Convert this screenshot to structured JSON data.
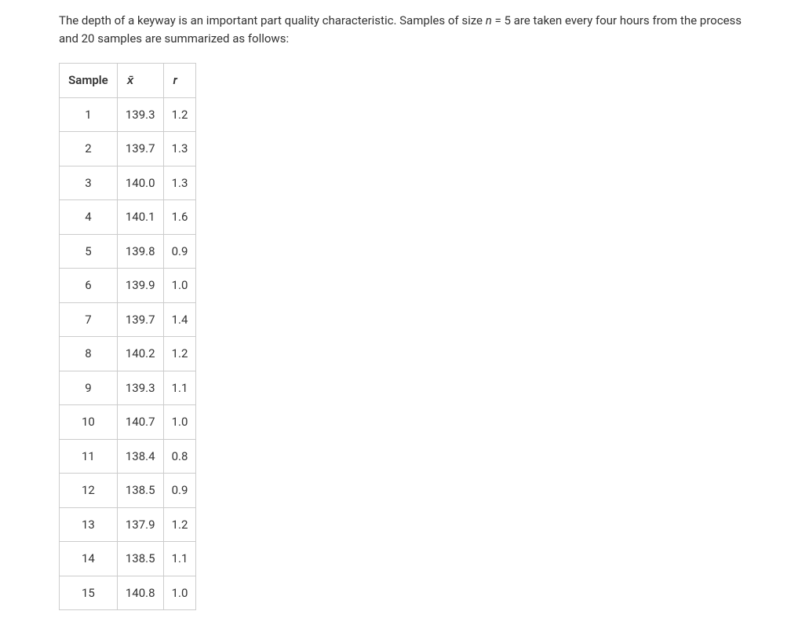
{
  "problem": {
    "text_part1": "The depth of a keyway is an important part quality characteristic. Samples of size ",
    "var_n": "n",
    "text_part2": " = 5 are taken every four hours from the process and 20 samples are summarized as follows:"
  },
  "table": {
    "headers": {
      "sample": "Sample",
      "xbar": "x̄",
      "r": "r"
    },
    "rows": [
      {
        "sample": "1",
        "xbar": "139.3",
        "r": "1.2"
      },
      {
        "sample": "2",
        "xbar": "139.7",
        "r": "1.3"
      },
      {
        "sample": "3",
        "xbar": "140.0",
        "r": "1.3"
      },
      {
        "sample": "4",
        "xbar": "140.1",
        "r": "1.6"
      },
      {
        "sample": "5",
        "xbar": "139.8",
        "r": "0.9"
      },
      {
        "sample": "6",
        "xbar": "139.9",
        "r": "1.0"
      },
      {
        "sample": "7",
        "xbar": "139.7",
        "r": "1.4"
      },
      {
        "sample": "8",
        "xbar": "140.2",
        "r": "1.2"
      },
      {
        "sample": "9",
        "xbar": "139.3",
        "r": "1.1"
      },
      {
        "sample": "10",
        "xbar": "140.7",
        "r": "1.0"
      },
      {
        "sample": "11",
        "xbar": "138.4",
        "r": "0.8"
      },
      {
        "sample": "12",
        "xbar": "138.5",
        "r": "0.9"
      },
      {
        "sample": "13",
        "xbar": "137.9",
        "r": "1.2"
      },
      {
        "sample": "14",
        "xbar": "138.5",
        "r": "1.1"
      },
      {
        "sample": "15",
        "xbar": "140.8",
        "r": "1.0"
      }
    ]
  }
}
